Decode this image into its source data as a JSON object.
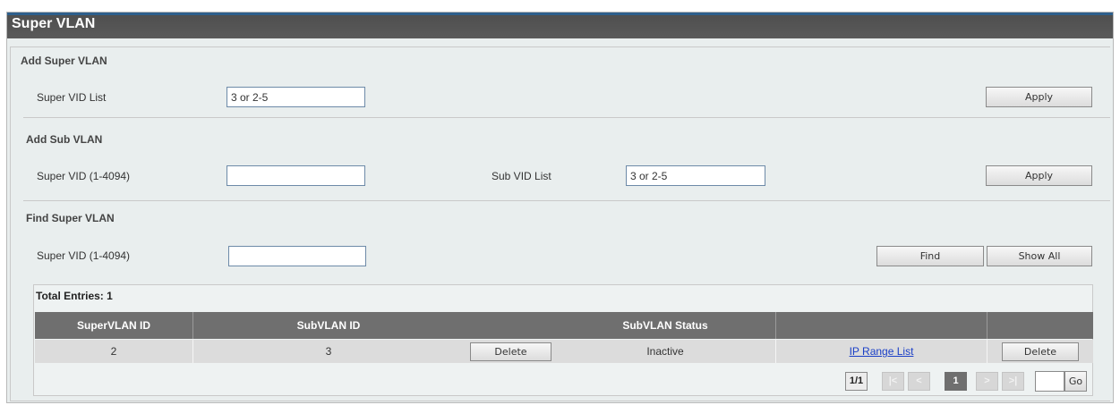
{
  "page": {
    "title": "Super VLAN"
  },
  "add_super_vlan": {
    "legend": "Add Super VLAN",
    "super_vid_list_label": "Super VID List",
    "super_vid_list_value": "3 or 2-5",
    "apply_label": "Apply"
  },
  "add_sub_vlan": {
    "title": "Add Sub VLAN",
    "super_vid_label": "Super VID (1-4094)",
    "super_vid_value": "",
    "sub_vid_list_label": "Sub VID List",
    "sub_vid_list_value": "3 or 2-5",
    "apply_label": "Apply"
  },
  "find_super_vlan": {
    "title": "Find Super VLAN",
    "super_vid_label": "Super VID (1-4094)",
    "super_vid_value": "",
    "find_label": "Find",
    "show_all_label": "Show All"
  },
  "table": {
    "total_entries": "Total Entries: 1",
    "headers": [
      "SuperVLAN ID",
      "SubVLAN ID",
      "SubVLAN Status",
      "",
      ""
    ],
    "rows": [
      {
        "supervlan_id": "2",
        "subvlan_id": "3",
        "delete_sub_label": "Delete",
        "status": "Inactive",
        "ip_range_label": "IP Range List",
        "delete_label": "Delete"
      }
    ]
  },
  "pagination": {
    "page_of": "1/1",
    "first": "|<",
    "prev": "<",
    "current": "1",
    "next": ">",
    "last": ">|",
    "goto_value": "",
    "go_label": "Go"
  }
}
